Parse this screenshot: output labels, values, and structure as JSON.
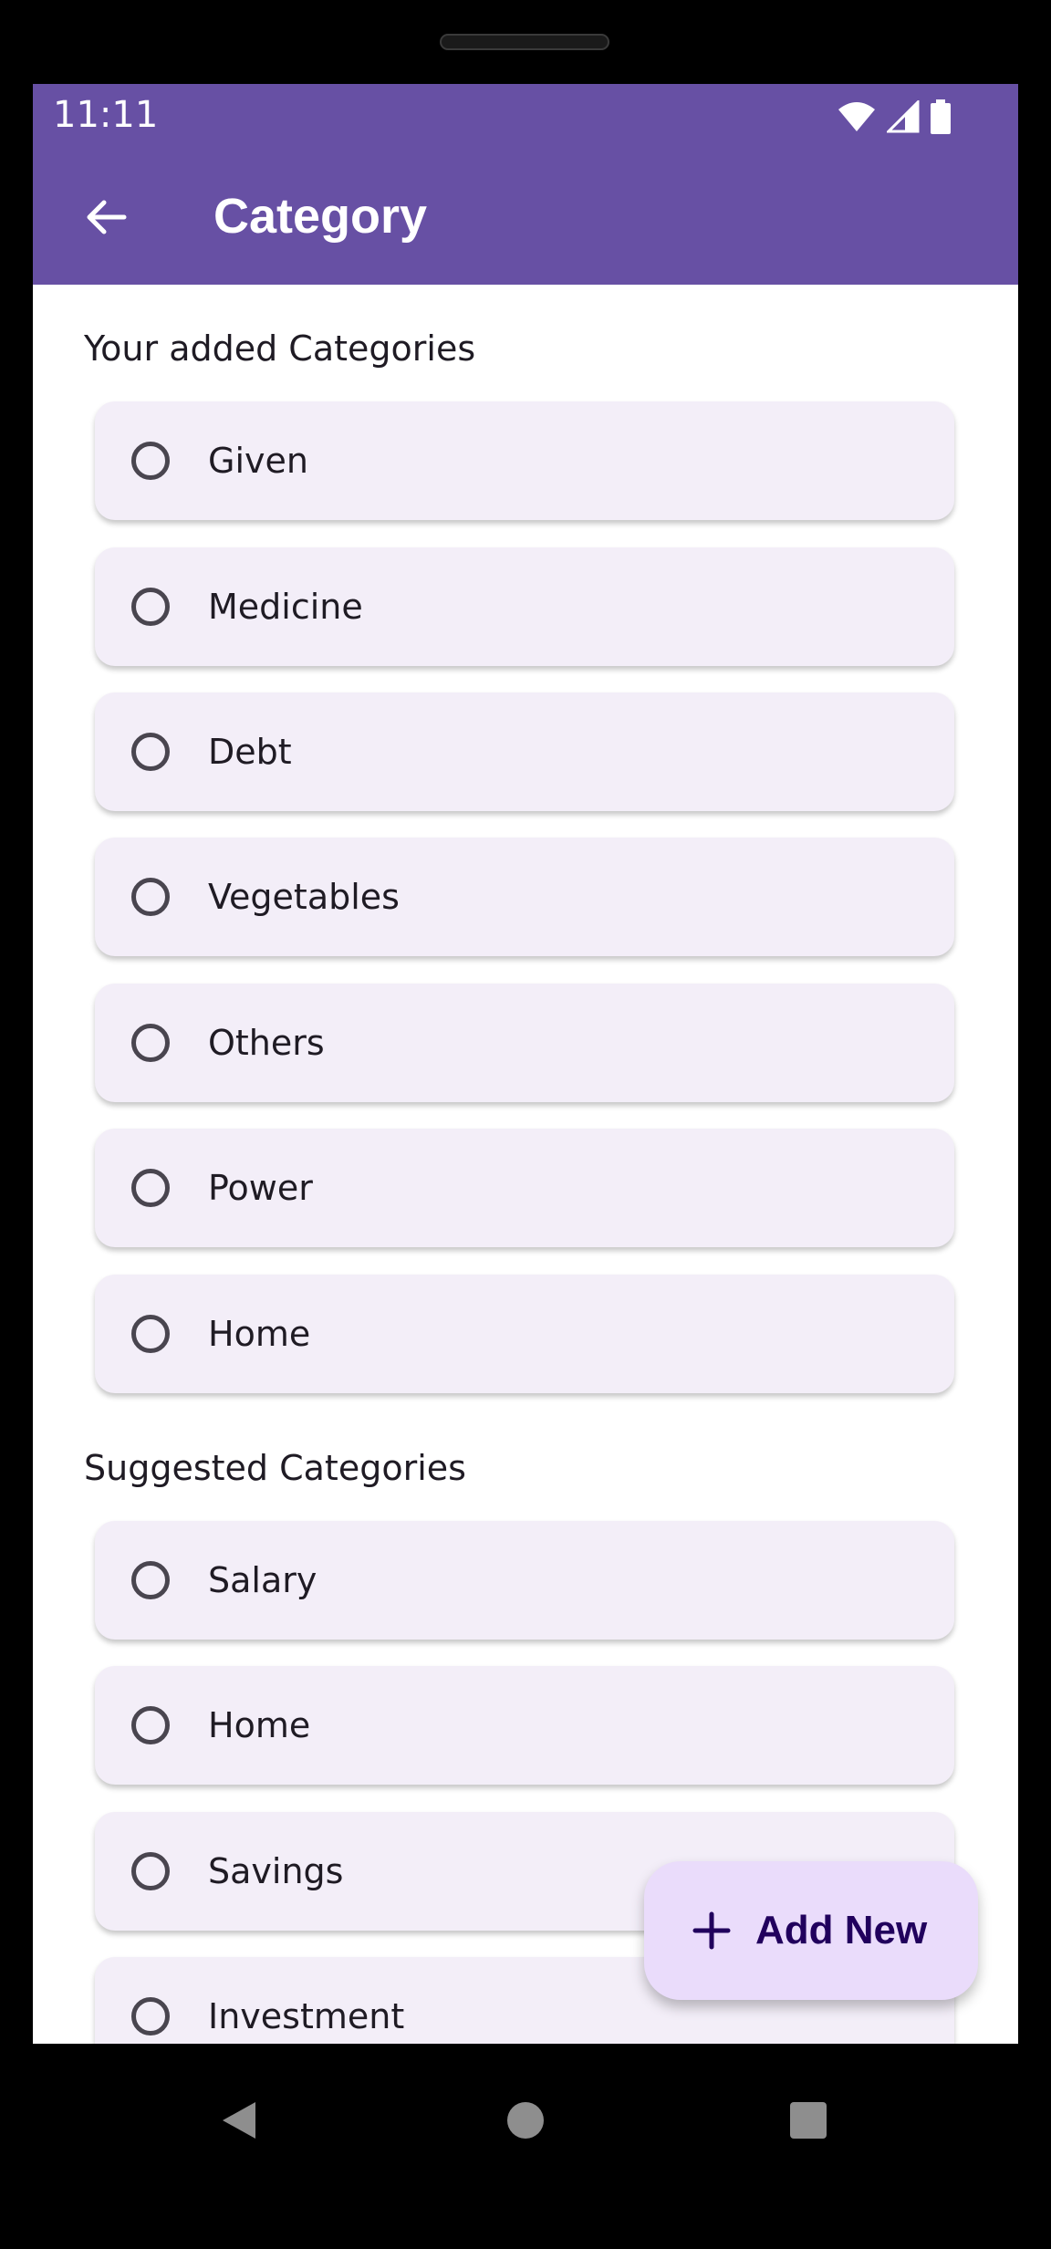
{
  "status_bar": {
    "time": "11:11",
    "icons": [
      "wifi-icon",
      "signal-icon",
      "battery-icon"
    ]
  },
  "app_bar": {
    "back_icon": "arrow-back-icon",
    "title": "Category"
  },
  "sections": {
    "added": {
      "title": "Your added Categories",
      "items": [
        {
          "label": "Given"
        },
        {
          "label": "Medicine"
        },
        {
          "label": "Debt"
        },
        {
          "label": "Vegetables"
        },
        {
          "label": "Others"
        },
        {
          "label": "Power"
        },
        {
          "label": "Home"
        }
      ]
    },
    "suggested": {
      "title": "Suggested Categories",
      "items": [
        {
          "label": "Salary"
        },
        {
          "label": "Home"
        },
        {
          "label": "Savings"
        },
        {
          "label": "Investment"
        }
      ]
    }
  },
  "fab": {
    "icon": "plus-icon",
    "label": "Add New"
  },
  "nav_bar": {
    "icons": [
      "back-triangle-icon",
      "home-circle-icon",
      "recents-square-icon"
    ]
  },
  "colors": {
    "primary": "#6750a4",
    "item_bg": "#f3eef8",
    "fab_bg": "#eadcfb",
    "fab_text": "#21005d",
    "text": "#1f1b24"
  }
}
